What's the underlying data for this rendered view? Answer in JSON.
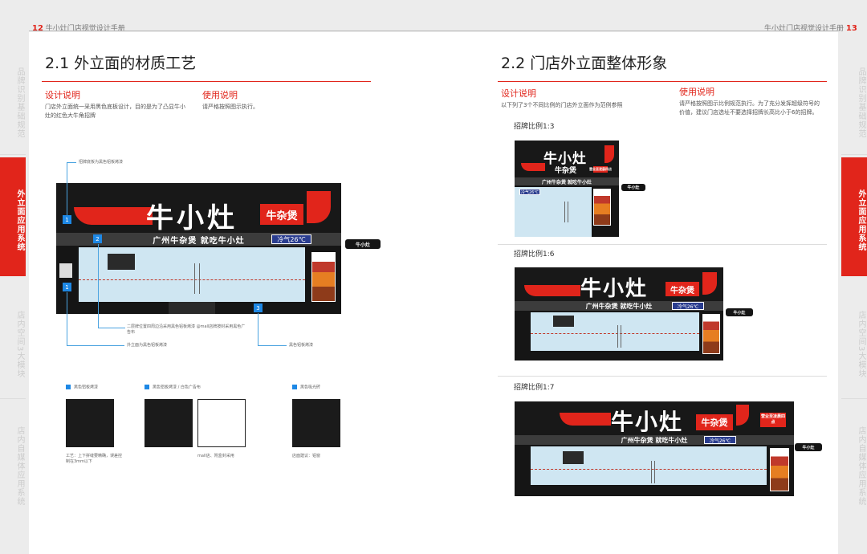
{
  "header": {
    "left_page_num": "12",
    "left_title": "牛小灶门店视觉设计手册",
    "right_title": "牛小灶门店视觉设计手册",
    "right_page_num": "13"
  },
  "left_tabs": [
    "品牌识别基础规范",
    "外立面应用系统",
    "店内空间3大模块",
    "店内自媒体应用系统"
  ],
  "right_tabs": [
    "品牌识别基础规范",
    "外立面应用系统",
    "店内空间3大模块",
    "店内自媒体应用系统"
  ],
  "active_tab_index": 1,
  "colors": {
    "accent": "#e1251b",
    "marker": "#1e88e5",
    "glass": "#cfe6f2"
  },
  "section_left": {
    "title": "2.1 外立面的材质工艺",
    "design_label": "设计说明",
    "design_text": "门店外立面统一采用黑色底板设计，目的是为了凸显牛小灶的红色大牛角招牌",
    "usage_label": "使用说明",
    "usage_text": "请严格按照图示执行。"
  },
  "storefront": {
    "brand": "牛小灶",
    "tag": "牛杂煲",
    "slogan": "广州牛杂煲 就吃牛小灶",
    "cold": "冷气26℃",
    "blade_brand": "牛小灶",
    "blade_sub": "牛杂煲",
    "poster_title": "牛小灶",
    "night_tag": "营业至凌晨四点"
  },
  "annotations": {
    "a1": "招牌底板为黑色铝板烤漆",
    "a2": "二层牌位置四周边沿采用黑色铝板烤漆 @mall店牌按封采用黑色广告布",
    "a3": "外立面为黑色铝板烤漆",
    "a4": "黑色铝板烤漆",
    "m1": "1",
    "m2": "2",
    "m3": "3"
  },
  "materials": [
    {
      "label": "黑色铝板烤漆",
      "note": "工艺：上下拼缝要精确，误差控制在3mm以下"
    },
    {
      "label": "黑色铝板烤漆 / 白色广告布",
      "note": "mall店、附盒封采用"
    },
    {
      "label": "黑色吸光砖",
      "note": "店面建议：铝窗"
    }
  ],
  "section_right": {
    "title": "2.2 门店外立面整体形象",
    "design_label": "设计说明",
    "design_text": "以下列了3个不同比例的门店外立面作为范例参照",
    "usage_label": "使用说明",
    "usage_text": "请严格按照图示比例规范执行。为了充分发挥超级符号的价值，建议门店选址不要选择招牌长高比小于6的招牌。"
  },
  "ratios": [
    "招牌比例1:3",
    "招牌比例1:6",
    "招牌比例1:7"
  ]
}
